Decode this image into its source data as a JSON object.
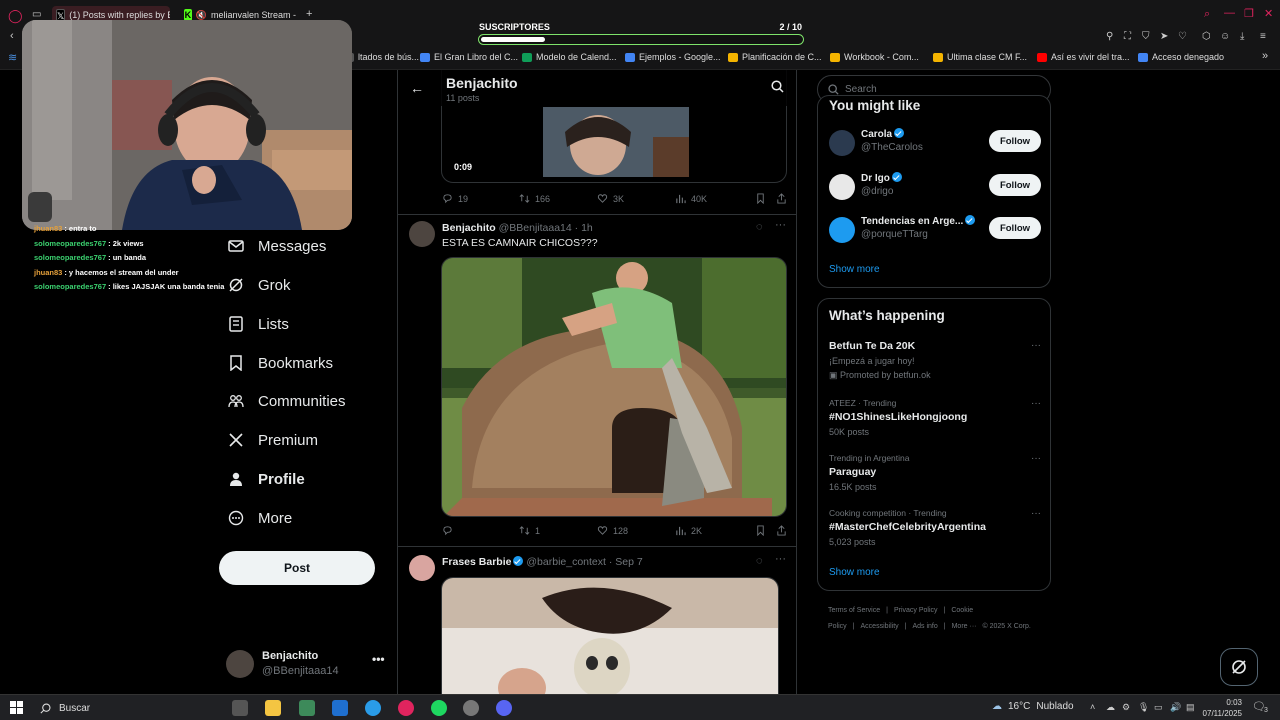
{
  "browser": {
    "tabs": [
      {
        "label": "(1) Posts with replies by B",
        "icon": "x-icon"
      },
      {
        "label": "melianvalen Stream -",
        "icon": "kick-icon"
      }
    ],
    "bookmarks": [
      {
        "label": "ltados de bús...",
        "color": "#555"
      },
      {
        "label": "El Gran Libro del C...",
        "color": "#4285f4"
      },
      {
        "label": "Modelo de Calend...",
        "color": "#0f9d58"
      },
      {
        "label": "Ejemplos - Google...",
        "color": "#4285f4"
      },
      {
        "label": "Planificación de C...",
        "color": "#f4b400"
      },
      {
        "label": "Workbook - Com...",
        "color": "#f4b400"
      },
      {
        "label": "Ultima clase CM F...",
        "color": "#f4b400"
      },
      {
        "label": "Así es vivir del tra...",
        "color": "#ff0000"
      },
      {
        "label": "Acceso denegado",
        "color": "#4285f4"
      }
    ]
  },
  "overlay": {
    "subs_label": "SUSCRIPTORES",
    "subs_count": "2 / 10",
    "subs_progress": 0.2
  },
  "chat": [
    {
      "user": "jhuan83",
      "text": ": entra to",
      "color": "#e6a13b"
    },
    {
      "user": "solomeoparedes767",
      "text": ": 2k views",
      "color": "#3bd16f"
    },
    {
      "user": "solomeoparedes767",
      "text": ": un banda",
      "color": "#3bd16f"
    },
    {
      "user": "jhuan83",
      "text": ": y hacemos el stream del under",
      "color": "#e6a13b"
    },
    {
      "user": "solomeoparedes767",
      "text": ": likes JAJSJAK una banda tenia",
      "color": "#3bd16f"
    }
  ],
  "nav": {
    "items": [
      {
        "label": "Messages",
        "icon": "mail-icon"
      },
      {
        "label": "Grok",
        "icon": "grok-icon"
      },
      {
        "label": "Lists",
        "icon": "list-icon"
      },
      {
        "label": "Bookmarks",
        "icon": "bookmark-icon"
      },
      {
        "label": "Communities",
        "icon": "communities-icon"
      },
      {
        "label": "Premium",
        "icon": "x-logo-icon"
      },
      {
        "label": "Profile",
        "icon": "person-icon"
      },
      {
        "label": "More",
        "icon": "more-circle-icon"
      }
    ],
    "post_label": "Post",
    "account_name": "Benjachito",
    "account_handle": "@BBenjitaaa14",
    "account_more": "•••"
  },
  "header": {
    "name": "Benjachito",
    "post_count": "11 posts"
  },
  "tweets": [
    {
      "video_time": "0:09",
      "replies": "19",
      "reposts": "166",
      "likes": "3K",
      "views": "40K"
    },
    {
      "author": "Benjachito",
      "handle": "@BBenjitaaa14 · 1h",
      "text": "ESTA ES CAMNAIR CHICOS???",
      "replies": "",
      "reposts": "1",
      "likes": "128",
      "views": "2K"
    },
    {
      "author": "Frases Barbie",
      "handle": "@barbie_context · Sep 7",
      "verified": true
    }
  ],
  "sidebar": {
    "search_placeholder": "Search",
    "wtf_title": "You might like",
    "follow_label": "Follow",
    "suggestions": [
      {
        "name": "Carola",
        "handle": "@TheCarolos",
        "verified": true
      },
      {
        "name": "Dr Igo",
        "handle": "@drigo",
        "verified": true
      },
      {
        "name": "Tendencias en Arge...",
        "handle": "@porqueTTarg",
        "verified": true
      }
    ],
    "show_more": "Show more",
    "happening_title": "What’s happening",
    "trends": [
      {
        "meta": "",
        "name": "Betfun Te Da 20K",
        "sub": "¡Empezá a jugar hoy!",
        "promo": "Promoted by betfun.ok"
      },
      {
        "meta": "ATEEZ · Trending",
        "name": "#NO1ShinesLikeHongjoong",
        "sub": "50K posts",
        "promo": ""
      },
      {
        "meta": "Trending in Argentina",
        "name": "Paraguay",
        "sub": "16.5K posts",
        "promo": ""
      },
      {
        "meta": "Cooking competition · Trending",
        "name": "#MasterChefCelebrityArgentina",
        "sub": "5,023 posts",
        "promo": ""
      }
    ],
    "footer": [
      "Terms of Service",
      "|",
      "Privacy Policy",
      "|",
      "Cookie Policy",
      "|",
      "Accessibility",
      "|",
      "Ads info",
      "|",
      "More ···",
      "© 2025 X Corp."
    ]
  },
  "taskbar": {
    "search_label": "Buscar",
    "temp": "16°C",
    "weather": "Nublado",
    "time": "0:03",
    "date": "07/11/2025",
    "notif_count": "3"
  }
}
